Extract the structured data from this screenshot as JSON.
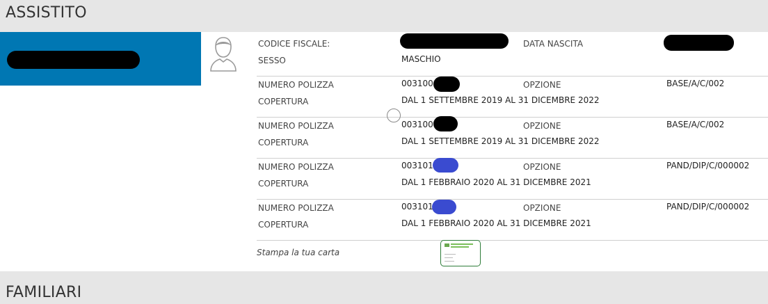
{
  "sections": {
    "assistito_title": "ASSISTITO",
    "familiari_title": "FAMILIARI"
  },
  "person": {
    "codice_fiscale_label": "CODICE FISCALE:",
    "data_nascita_label": "DATA NASCITA",
    "sesso_label": "SESSO",
    "sesso_value": "MASCHIO"
  },
  "policies": [
    {
      "numero_label": "NUMERO POLIZZA",
      "numero_value": "003100",
      "opzione_label": "OPZIONE",
      "opzione_value": "BASE/A/C/002",
      "copertura_label": "COPERTURA",
      "copertura_value": "DAL 1 SETTEMBRE 2019 AL 31 DICEMBRE 2022"
    },
    {
      "numero_label": "NUMERO POLIZZA",
      "numero_value": "003100",
      "opzione_label": "OPZIONE",
      "opzione_value": "BASE/A/C/002",
      "copertura_label": "COPERTURA",
      "copertura_value": "DAL 1 SETTEMBRE 2019 AL 31 DICEMBRE 2022"
    },
    {
      "numero_label": "NUMERO POLIZZA",
      "numero_value": "003101",
      "opzione_label": "OPZIONE",
      "opzione_value": "PAND/DIP/C/000002",
      "copertura_label": "COPERTURA",
      "copertura_value": "DAL 1 FEBBRAIO 2020 AL 31 DICEMBRE 2021"
    },
    {
      "numero_label": "NUMERO POLIZZA",
      "numero_value": "003101",
      "opzione_label": "OPZIONE",
      "opzione_value": "PAND/DIP/C/000002",
      "copertura_label": "COPERTURA",
      "copertura_value": "DAL 1 FEBBRAIO 2020 AL 31 DICEMBRE 2021"
    }
  ],
  "print_card": {
    "label": "Stampa la tua carta"
  }
}
